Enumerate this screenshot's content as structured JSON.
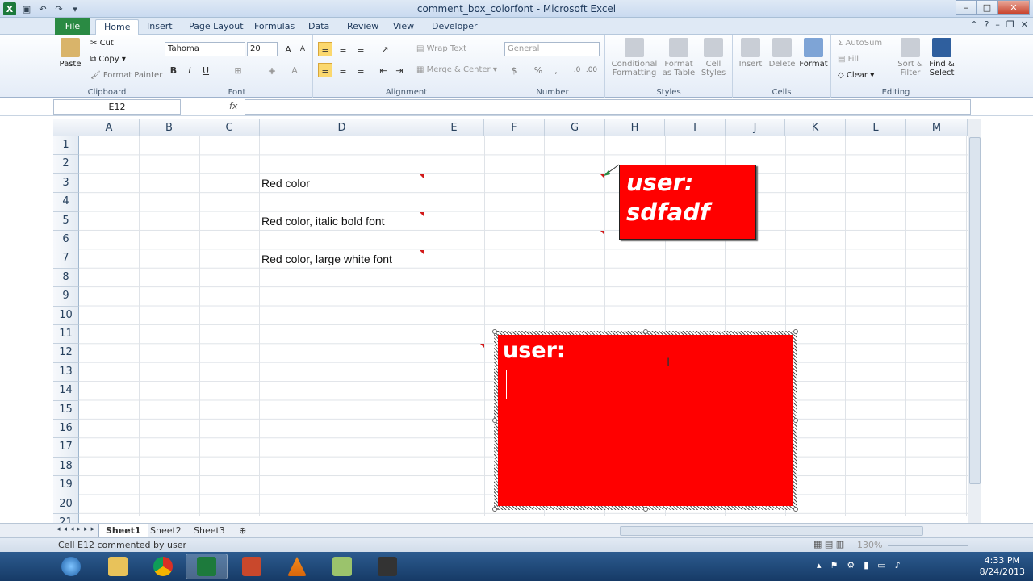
{
  "window": {
    "title": "comment_box_colorfont - Microsoft Excel"
  },
  "tabs": [
    "File",
    "Home",
    "Insert",
    "Page Layout",
    "Formulas",
    "Data",
    "Review",
    "View",
    "Developer"
  ],
  "ribbon": {
    "clipboard": {
      "paste": "Paste",
      "cut": "Cut",
      "copy": "Copy",
      "format_painter": "Format Painter",
      "label": "Clipboard"
    },
    "font": {
      "family": "Tahoma",
      "size": "20",
      "label": "Font"
    },
    "alignment": {
      "wrap": "Wrap Text",
      "merge": "Merge & Center",
      "label": "Alignment"
    },
    "number": {
      "format": "General",
      "label": "Number"
    },
    "styles": {
      "conditional": "Conditional Formatting",
      "table": "Format as Table",
      "cell": "Cell Styles",
      "label": "Styles"
    },
    "cells": {
      "insert": "Insert",
      "delete": "Delete",
      "format": "Format",
      "label": "Cells"
    },
    "editing": {
      "autosum": "AutoSum",
      "fill": "Fill",
      "clear": "Clear",
      "sort": "Sort & Filter",
      "find": "Find & Select",
      "label": "Editing"
    }
  },
  "formula_bar": {
    "name_box": "E12",
    "fx": "fx",
    "value": ""
  },
  "columns": [
    "A",
    "B",
    "C",
    "D",
    "E",
    "F",
    "G",
    "H",
    "I",
    "J",
    "K",
    "L",
    "M"
  ],
  "rows": [
    "1",
    "2",
    "3",
    "4",
    "5",
    "6",
    "7",
    "8",
    "9",
    "10",
    "11",
    "12",
    "13",
    "14",
    "15",
    "16",
    "17",
    "18",
    "19",
    "20",
    "21"
  ],
  "cells": {
    "d3": "Red color",
    "d5": "Red color, italic bold font",
    "d7": "Red color, large white font"
  },
  "comments": {
    "c1_line1": "user:",
    "c1_line2": "sdfadf",
    "c2_text": "user:"
  },
  "sheets": [
    "Sheet1",
    "Sheet2",
    "Sheet3"
  ],
  "status": {
    "text": "Cell E12 commented by user",
    "zoom": "130%"
  },
  "taskbar": {
    "time": "4:33 PM",
    "date": "8/24/2013"
  }
}
